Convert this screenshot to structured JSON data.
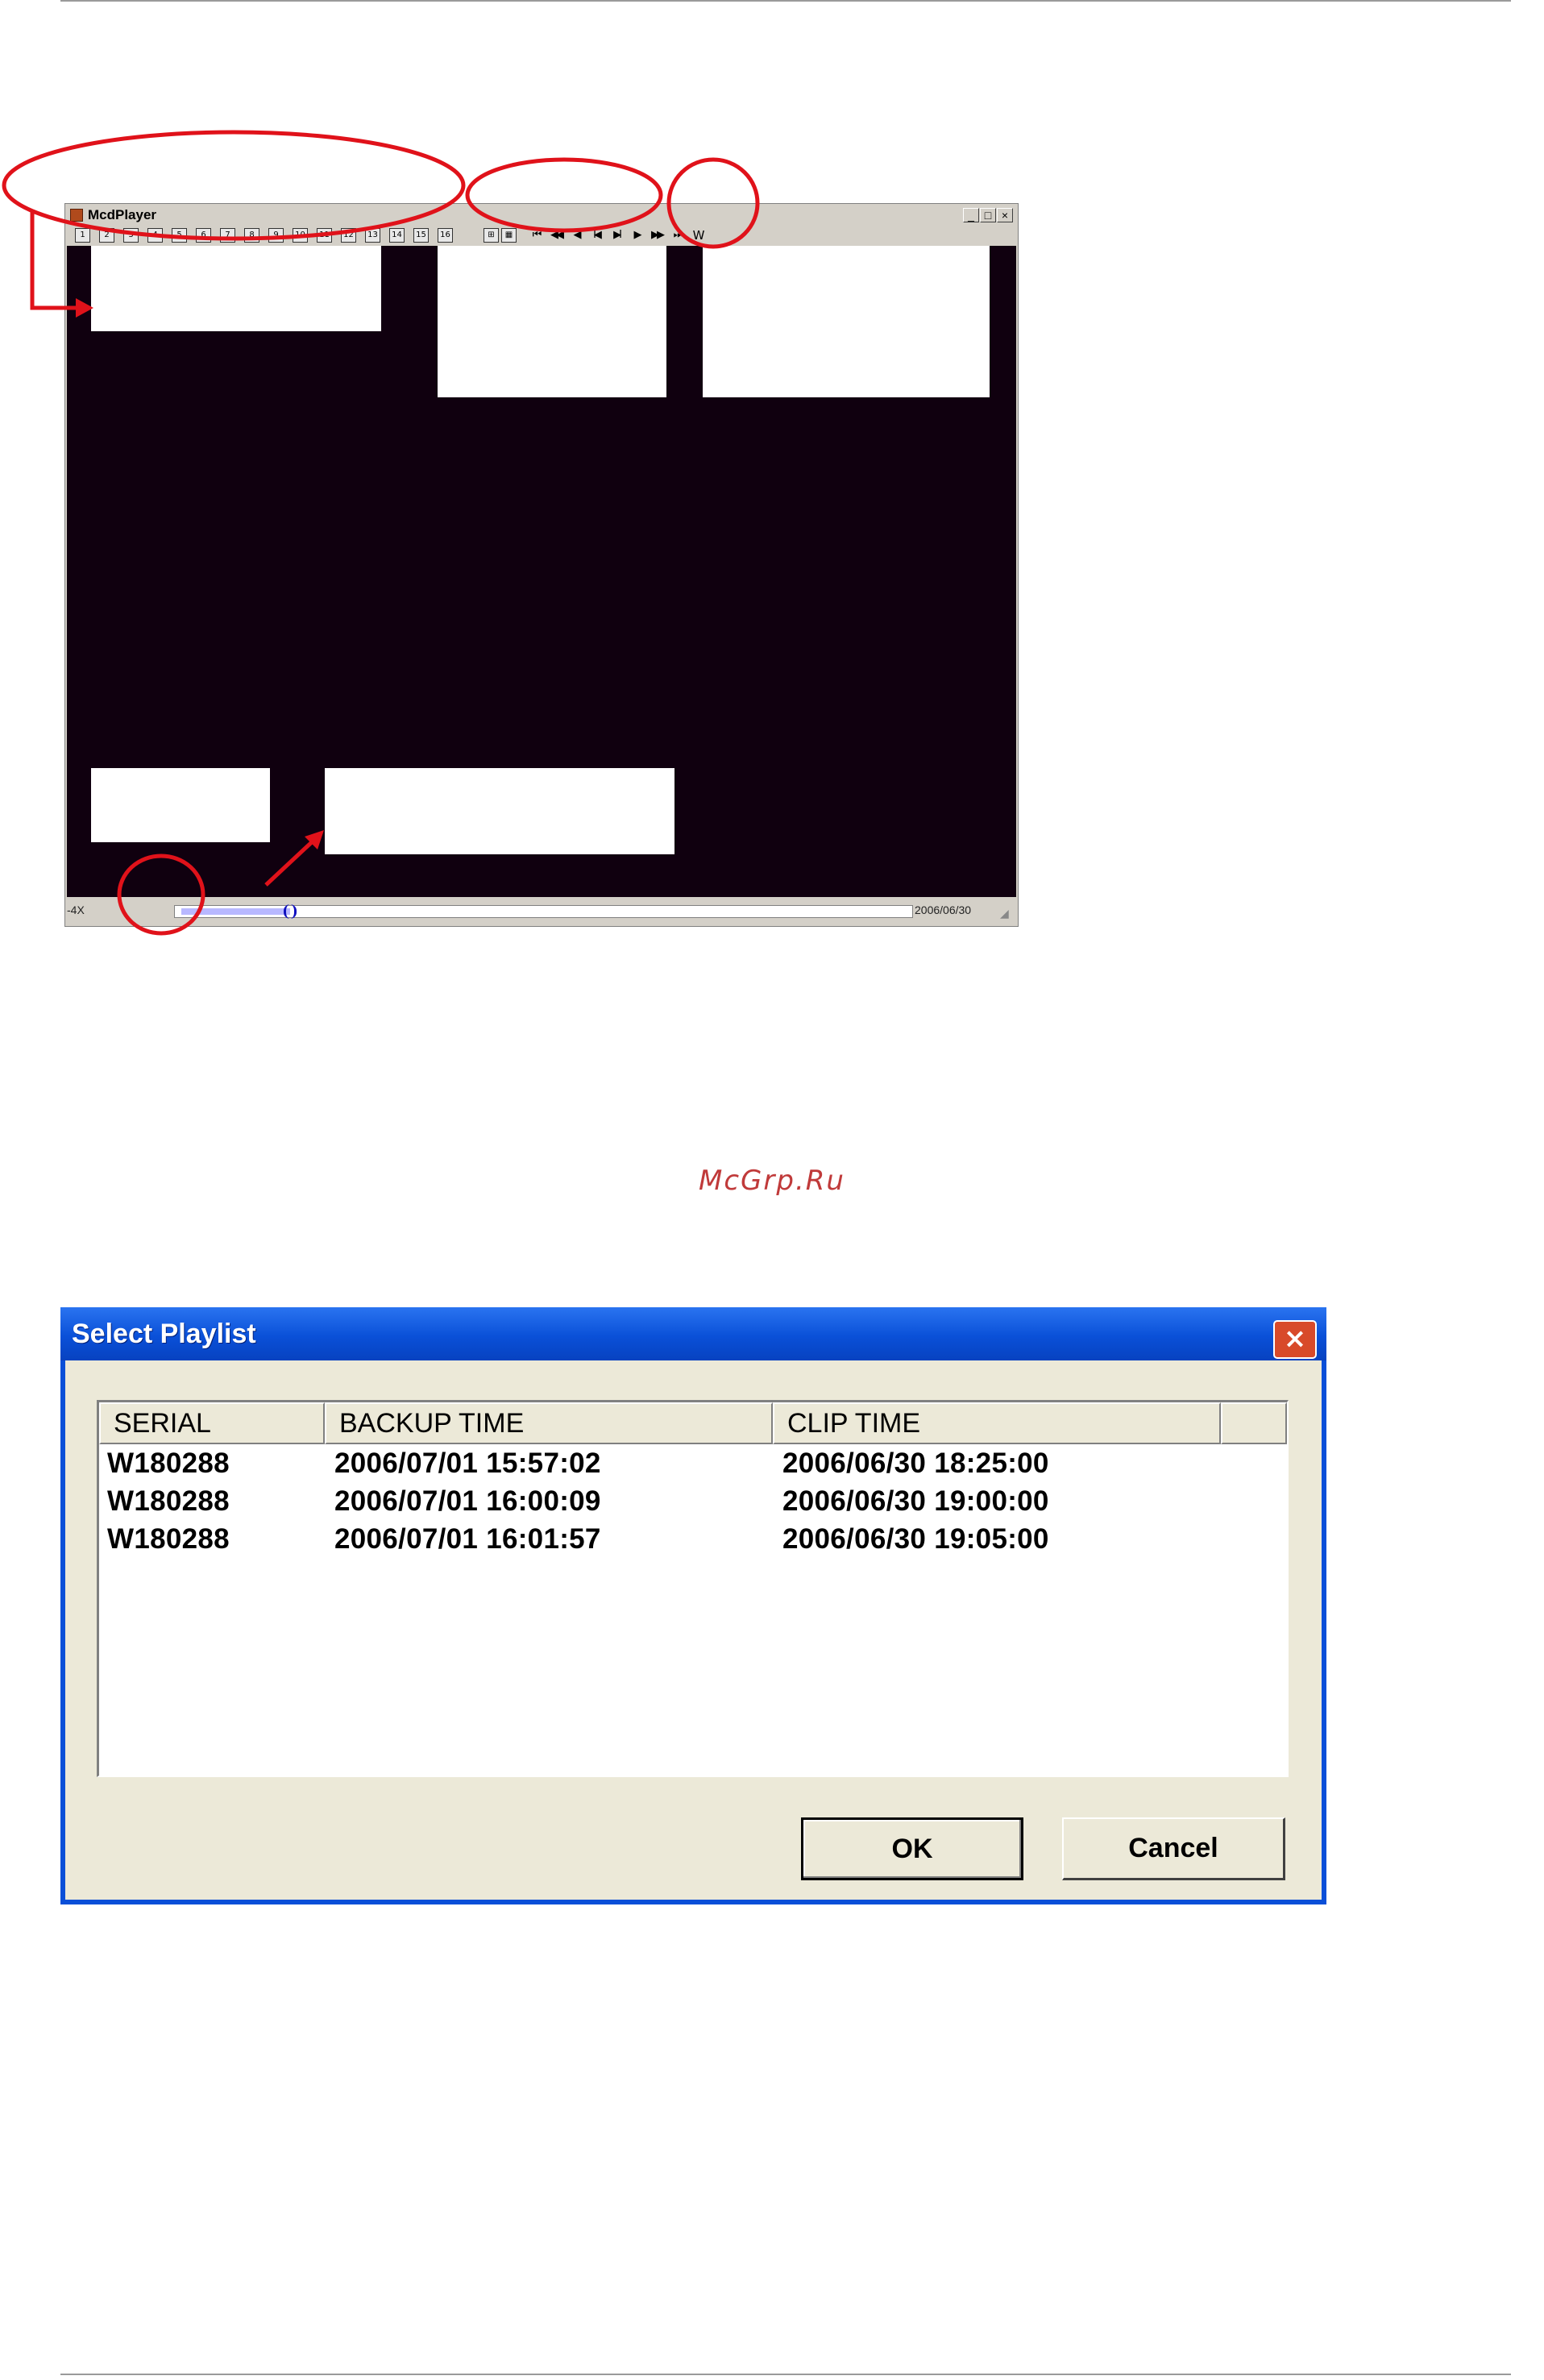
{
  "player": {
    "title": "McdPlayer",
    "window_buttons": {
      "minimize": "_",
      "maximize": "□",
      "close": "×"
    },
    "toolbar": {
      "channels": [
        "1",
        "2",
        "3",
        "4",
        "5",
        "6",
        "7",
        "8",
        "9",
        "10",
        "11",
        "12",
        "13",
        "14",
        "15",
        "16"
      ],
      "layouts": [
        "quad-split-icon",
        "grid-split-icon"
      ],
      "playback": [
        "⏮",
        "◀◀",
        "◀",
        "I◀",
        "▶I",
        "▶",
        "▶▶",
        "⏭"
      ],
      "extra": "W"
    },
    "status": {
      "speed": "-4X",
      "date": "2006/06/30",
      "progress": 0.06
    }
  },
  "watermark": "McGrp.Ru",
  "dialog": {
    "title": "Select Playlist",
    "columns": [
      "SERIAL",
      "BACKUP TIME",
      "CLIP TIME",
      ""
    ],
    "rows": [
      {
        "serial": "W180288",
        "backup_time": "2006/07/01 15:57:02",
        "clip_time": "2006/06/30 18:25:00"
      },
      {
        "serial": "W180288",
        "backup_time": "2006/07/01 16:00:09",
        "clip_time": "2006/06/30 19:00:00"
      },
      {
        "serial": "W180288",
        "backup_time": "2006/07/01 16:01:57",
        "clip_time": "2006/06/30 19:05:00"
      }
    ],
    "ok_label": "OK",
    "cancel_label": "Cancel",
    "close_glyph": "×"
  },
  "colors": {
    "annotation": "#e0121a",
    "video_bg": "#10000f",
    "xp_title": "#0a50d8"
  }
}
